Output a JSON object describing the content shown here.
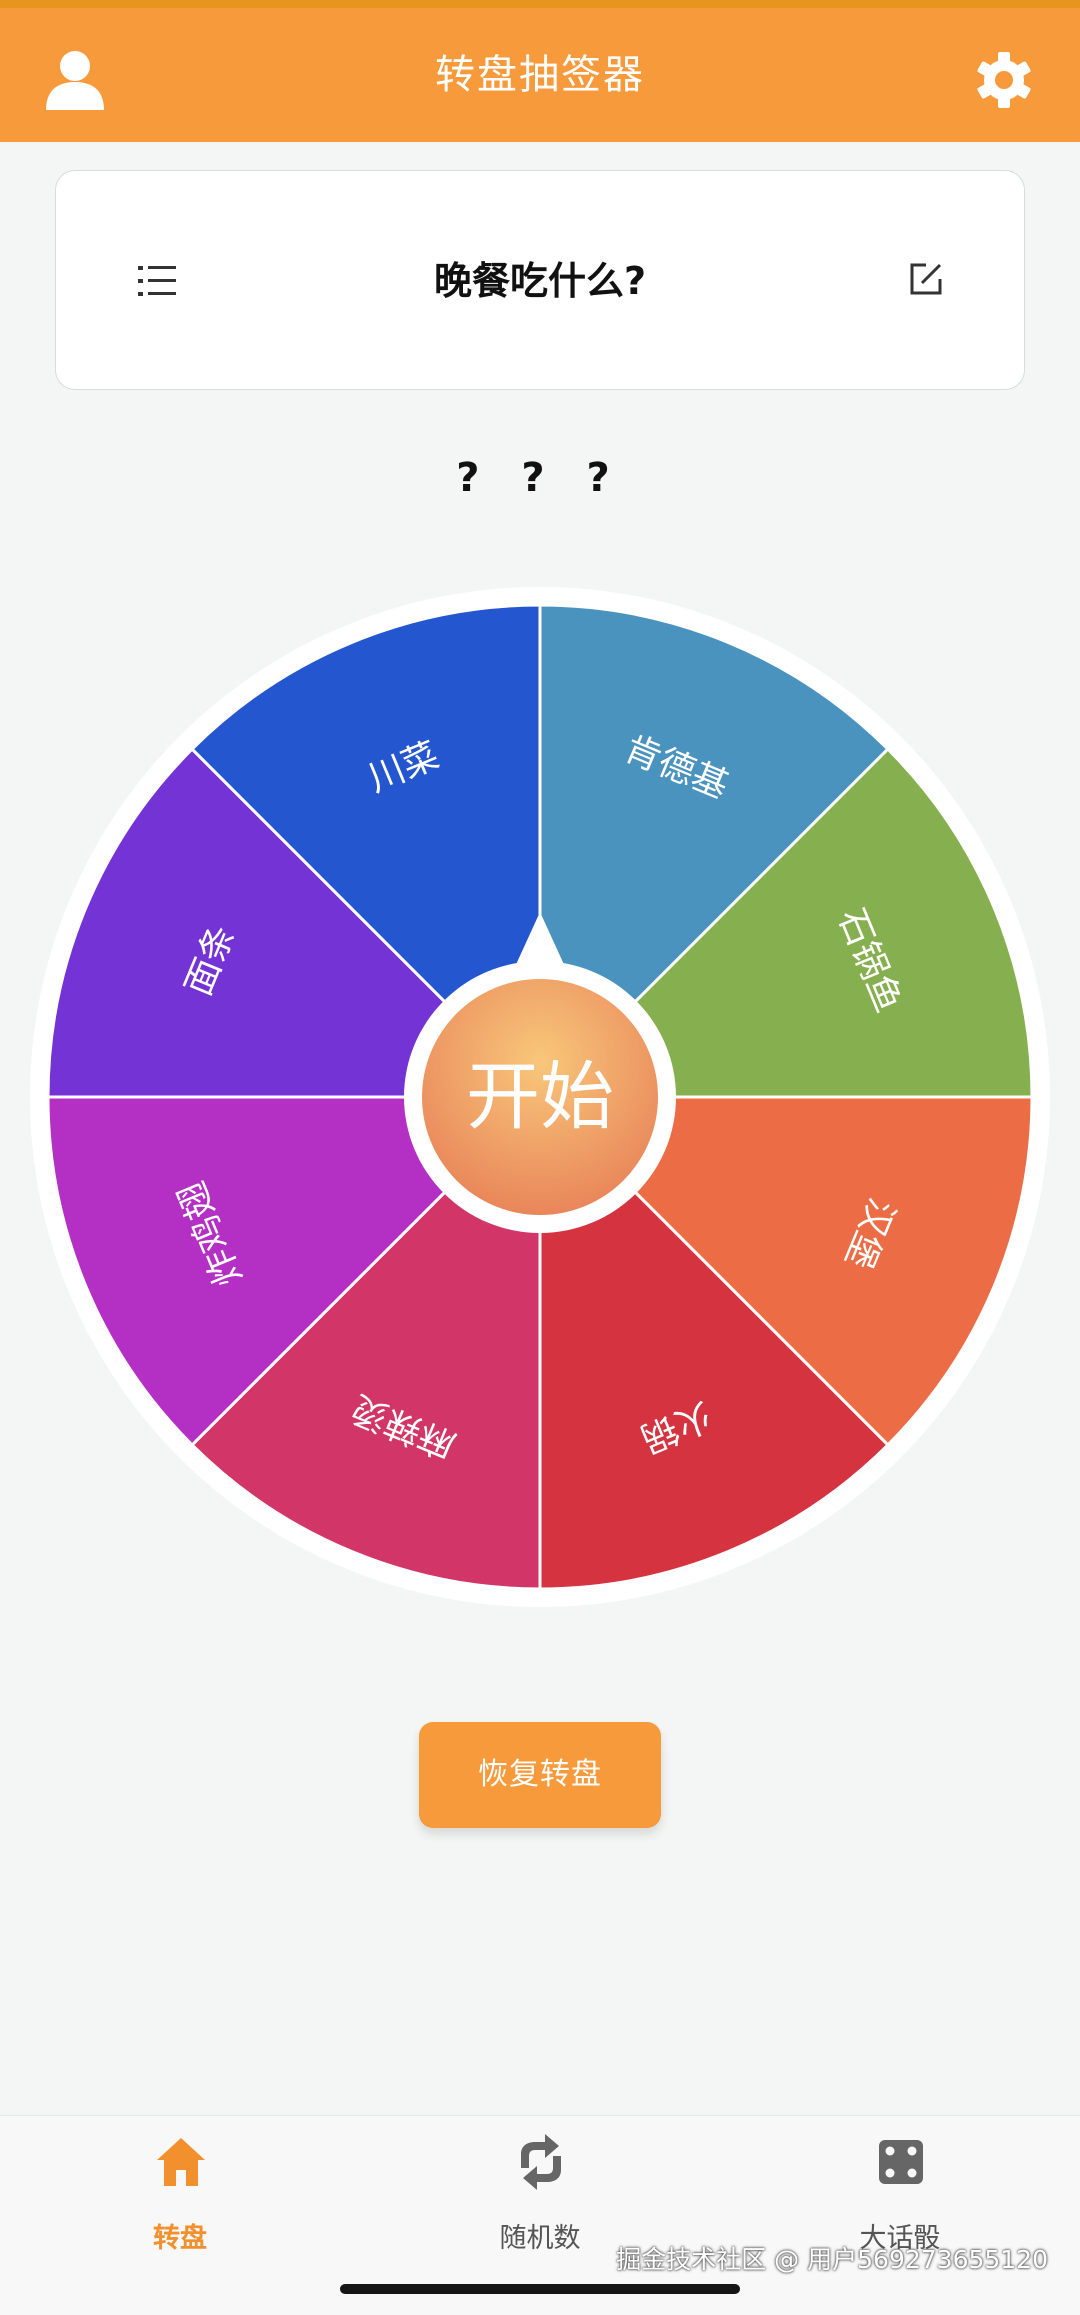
{
  "header": {
    "title": "转盘抽签器"
  },
  "card": {
    "title": "晚餐吃什么?"
  },
  "result": {
    "text": "? ? ?"
  },
  "wheel": {
    "start_label": "开始",
    "segments": [
      {
        "label": "肯德基",
        "color": "#4a93bf"
      },
      {
        "label": "石锅鱼",
        "color": "#86b04f"
      },
      {
        "label": "汉堡",
        "color": "#ec6c45"
      },
      {
        "label": "火锅",
        "color": "#d4333f"
      },
      {
        "label": "麻辣烫",
        "color": "#d23568"
      },
      {
        "label": "炸鸡翅",
        "color": "#b42fc4"
      },
      {
        "label": "面条",
        "color": "#7433d4"
      },
      {
        "label": "川菜",
        "color": "#2456cf"
      }
    ]
  },
  "restore_button": {
    "label": "恢复转盘"
  },
  "tabs": [
    {
      "label": "转盘",
      "icon": "home-icon",
      "active": true
    },
    {
      "label": "随机数",
      "icon": "refresh-arrows-icon",
      "active": false
    },
    {
      "label": "大话骰",
      "icon": "dice-icon",
      "active": false
    }
  ],
  "watermark": "掘金技术社区 @ 用户569273655120",
  "colors": {
    "accent": "#f79a3b",
    "active_tab": "#f2902d"
  }
}
